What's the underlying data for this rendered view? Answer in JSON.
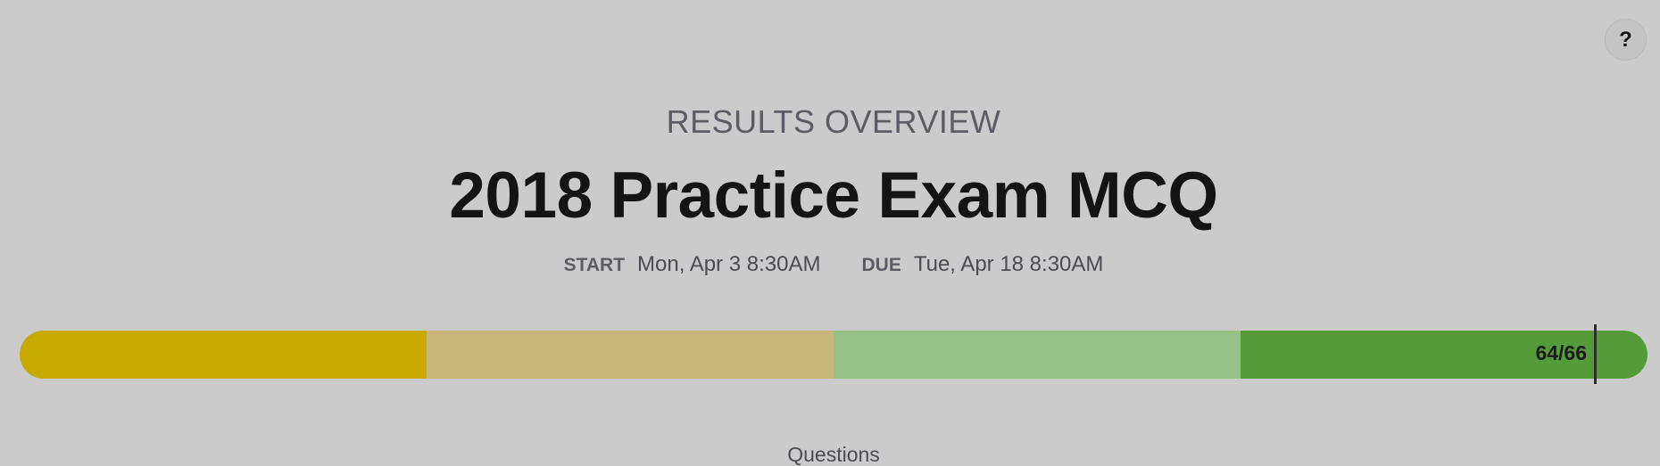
{
  "help": {
    "label": "?"
  },
  "header": {
    "overview_label": "RESULTS OVERVIEW",
    "title": "2018 Practice Exam MCQ"
  },
  "dates": {
    "start_label": "START",
    "start_value": "Mon, Apr 3 8:30AM",
    "due_label": "DUE",
    "due_value": "Tue, Apr 18 8:30AM"
  },
  "progress": {
    "score_text": "64/66",
    "score": 64,
    "total": 66,
    "segment_colors": [
      "#c9aa00",
      "#c9b67a",
      "#96c286",
      "#559b3a"
    ]
  },
  "footer": {
    "questions_label": "Questions"
  }
}
